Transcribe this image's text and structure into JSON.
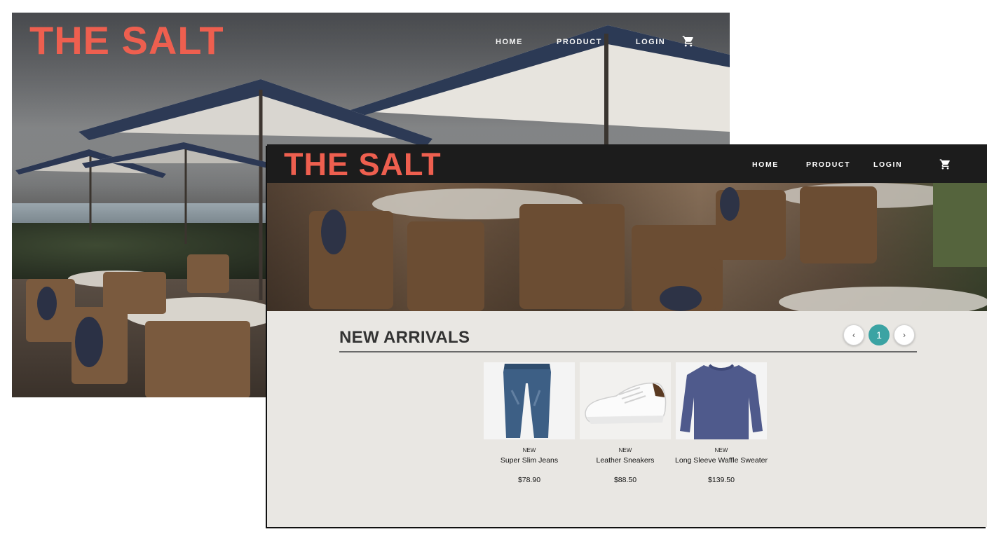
{
  "back": {
    "logo": "THE SALT",
    "nav": [
      "HOME",
      "PRODUCT",
      "LOGIN"
    ],
    "cart_icon": "cart-icon"
  },
  "front": {
    "logo": "THE SALT",
    "nav": [
      "HOME",
      "PRODUCT",
      "LOGIN"
    ],
    "cart_icon": "cart-icon",
    "section_title": "NEW ARRIVALS",
    "pager": {
      "prev": "‹",
      "current": "1",
      "next": "›"
    },
    "products": [
      {
        "badge": "NEW",
        "name": "Super Slim Jeans",
        "price": "$78.90"
      },
      {
        "badge": "NEW",
        "name": "Leather Sneakers",
        "price": "$88.50"
      },
      {
        "badge": "NEW",
        "name": "Long Sleeve Waffle Sweater",
        "price": "$139.50"
      }
    ]
  },
  "colors": {
    "brand": "#ee5f4f",
    "header_bg": "#1c1c1c",
    "page_bg": "#e9e7e3",
    "accent": "#3ba3a3"
  }
}
